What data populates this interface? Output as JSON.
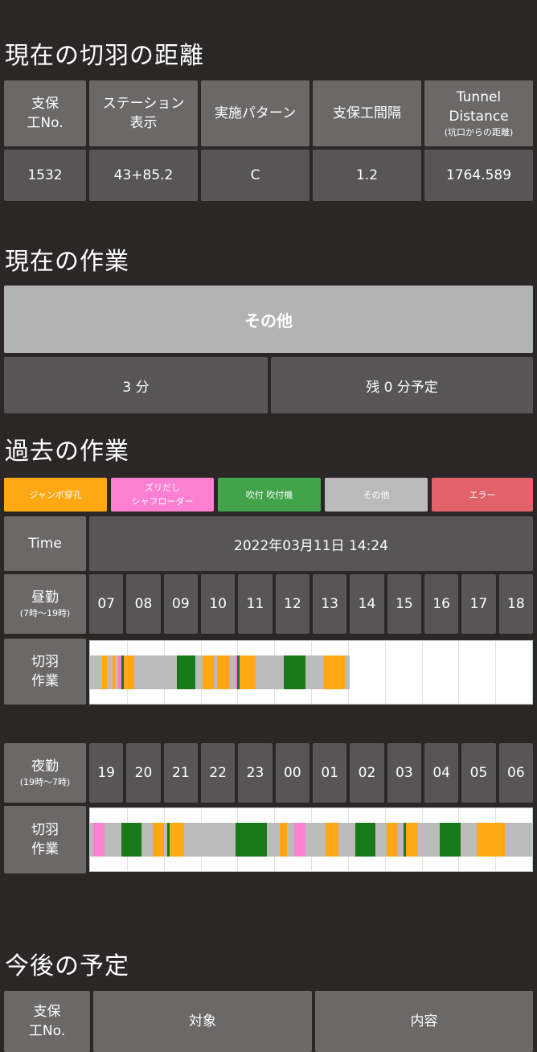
{
  "distance": {
    "title": "現在の切羽の距離",
    "headers": [
      {
        "line1": "支保",
        "line2": "工No.",
        "small": ""
      },
      {
        "line1": "ステーション",
        "line2": "表示",
        "small": ""
      },
      {
        "line1": "実施パターン",
        "line2": "",
        "small": ""
      },
      {
        "line1": "支保工間隔",
        "line2": "",
        "small": ""
      },
      {
        "line1": "Tunnel",
        "line2": "Distance",
        "small": "(坑口からの距離)"
      }
    ],
    "values": [
      "1532",
      "43+85.2",
      "C",
      "1.2",
      "1764.589"
    ]
  },
  "current_work": {
    "title": "現在の作業",
    "activity": "その他",
    "elapsed": "3 分",
    "remaining": "残 0 分予定"
  },
  "past_work": {
    "title": "過去の作業",
    "legend": [
      {
        "line1": "ジャンボ穿孔",
        "line2": "",
        "color": "#ffa814"
      },
      {
        "line1": "ズリだし",
        "line2": "シャフローダー",
        "color": "#fd7fd2"
      },
      {
        "line1": "吹付 吹付機",
        "line2": "",
        "color": "#42a44a"
      },
      {
        "line1": "その他",
        "line2": "",
        "color": "#bbbbbb"
      },
      {
        "line1": "エラー",
        "line2": "",
        "color": "#e2626a"
      }
    ],
    "time_label": "Time",
    "datetime": "2022年03月11日 14:24",
    "day": {
      "label": "昼勤",
      "sub": "(7時〜19時)",
      "row_label_1": "切羽",
      "row_label_2": "作業",
      "hours": [
        "07",
        "08",
        "09",
        "10",
        "11",
        "12",
        "13",
        "14",
        "15",
        "16",
        "17",
        "18"
      ]
    },
    "night": {
      "label": "夜勤",
      "sub": "(19時〜7時)",
      "row_label_1": "切羽",
      "row_label_2": "作業",
      "hours": [
        "19",
        "20",
        "21",
        "22",
        "23",
        "00",
        "01",
        "02",
        "03",
        "04",
        "05",
        "06"
      ]
    }
  },
  "future": {
    "title": "今後の予定",
    "col1_line1": "支保",
    "col1_line2": "工No.",
    "col2": "対象",
    "col3": "内容"
  },
  "chart_data": [
    {
      "type": "bar",
      "title": "",
      "xlabel": "",
      "ylabel": "",
      "x_range_hours": [
        7,
        19
      ],
      "note_units": "hours from 07:00",
      "segments": [
        {
          "start": 7.0,
          "end": 7.33,
          "activity": "その他",
          "color": "#bbbbbb"
        },
        {
          "start": 7.33,
          "end": 7.45,
          "activity": "ジャンボ穿孔",
          "color": "#ffa814"
        },
        {
          "start": 7.45,
          "end": 7.6,
          "activity": "その他",
          "color": "#bbbbbb"
        },
        {
          "start": 7.6,
          "end": 7.67,
          "activity": "ジャンボ穿孔",
          "color": "#ffa814"
        },
        {
          "start": 7.67,
          "end": 7.77,
          "activity": "その他",
          "color": "#bbbbbb"
        },
        {
          "start": 7.77,
          "end": 7.85,
          "activity": "ズリだし",
          "color": "#fd7fd2"
        },
        {
          "start": 7.85,
          "end": 7.92,
          "activity": "吹付",
          "color": "#1a7a1a"
        },
        {
          "start": 7.92,
          "end": 8.2,
          "activity": "ジャンボ穿孔",
          "color": "#ffa814"
        },
        {
          "start": 8.2,
          "end": 9.35,
          "activity": "その他",
          "color": "#bbbbbb"
        },
        {
          "start": 9.35,
          "end": 9.85,
          "activity": "吹付",
          "color": "#1a7a1a"
        },
        {
          "start": 9.85,
          "end": 10.05,
          "activity": "その他",
          "color": "#bbbbbb"
        },
        {
          "start": 10.05,
          "end": 10.35,
          "activity": "ジャンボ穿孔",
          "color": "#ffa814"
        },
        {
          "start": 10.35,
          "end": 10.45,
          "activity": "その他",
          "color": "#bbbbbb"
        },
        {
          "start": 10.45,
          "end": 10.8,
          "activity": "ジャンボ穿孔",
          "color": "#ffa814"
        },
        {
          "start": 10.8,
          "end": 10.95,
          "activity": "その他",
          "color": "#bbbbbb"
        },
        {
          "start": 10.95,
          "end": 11.0,
          "activity": "ズリだし",
          "color": "#fd7fd2"
        },
        {
          "start": 11.0,
          "end": 11.05,
          "activity": "吹付",
          "color": "#1a7a1a"
        },
        {
          "start": 11.05,
          "end": 11.5,
          "activity": "ジャンボ穿孔",
          "color": "#ffa814"
        },
        {
          "start": 11.5,
          "end": 12.25,
          "activity": "その他",
          "color": "#bbbbbb"
        },
        {
          "start": 12.25,
          "end": 12.85,
          "activity": "吹付",
          "color": "#1a7a1a"
        },
        {
          "start": 12.85,
          "end": 13.35,
          "activity": "その他",
          "color": "#bbbbbb"
        },
        {
          "start": 13.35,
          "end": 13.92,
          "activity": "ジャンボ穿孔",
          "color": "#ffa814"
        },
        {
          "start": 13.92,
          "end": 14.05,
          "activity": "その他",
          "color": "#bbbbbb"
        }
      ]
    },
    {
      "type": "bar",
      "title": "",
      "xlabel": "",
      "ylabel": "",
      "x_range_hours": [
        0,
        12
      ],
      "note_units": "hours from 19:00",
      "segments": [
        {
          "start": 0.0,
          "end": 0.08,
          "activity": "その他",
          "color": "#bbbbbb"
        },
        {
          "start": 0.08,
          "end": 0.4,
          "activity": "ズリだし",
          "color": "#fd7fd2"
        },
        {
          "start": 0.4,
          "end": 0.85,
          "activity": "その他",
          "color": "#bbbbbb"
        },
        {
          "start": 0.85,
          "end": 1.4,
          "activity": "吹付",
          "color": "#1a7a1a"
        },
        {
          "start": 1.4,
          "end": 1.7,
          "activity": "その他",
          "color": "#bbbbbb"
        },
        {
          "start": 1.7,
          "end": 2.0,
          "activity": "ジャンボ穿孔",
          "color": "#ffa814"
        },
        {
          "start": 2.0,
          "end": 2.1,
          "activity": "その他",
          "color": "#bbbbbb"
        },
        {
          "start": 2.1,
          "end": 2.17,
          "activity": "吹付",
          "color": "#1a7a1a"
        },
        {
          "start": 2.17,
          "end": 2.55,
          "activity": "ジャンボ穿孔",
          "color": "#ffa814"
        },
        {
          "start": 2.55,
          "end": 3.95,
          "activity": "その他",
          "color": "#bbbbbb"
        },
        {
          "start": 3.95,
          "end": 4.8,
          "activity": "吹付",
          "color": "#1a7a1a"
        },
        {
          "start": 4.8,
          "end": 5.15,
          "activity": "その他",
          "color": "#bbbbbb"
        },
        {
          "start": 5.15,
          "end": 5.35,
          "activity": "ジャンボ穿孔",
          "color": "#ffa814"
        },
        {
          "start": 5.35,
          "end": 5.55,
          "activity": "その他",
          "color": "#bbbbbb"
        },
        {
          "start": 5.55,
          "end": 5.85,
          "activity": "ズリだし",
          "color": "#fd7fd2"
        },
        {
          "start": 5.85,
          "end": 6.4,
          "activity": "その他",
          "color": "#bbbbbb"
        },
        {
          "start": 6.4,
          "end": 6.75,
          "activity": "ジャンボ穿孔",
          "color": "#ffa814"
        },
        {
          "start": 6.75,
          "end": 7.2,
          "activity": "その他",
          "color": "#bbbbbb"
        },
        {
          "start": 7.2,
          "end": 7.75,
          "activity": "吹付",
          "color": "#1a7a1a"
        },
        {
          "start": 7.75,
          "end": 8.05,
          "activity": "その他",
          "color": "#bbbbbb"
        },
        {
          "start": 8.05,
          "end": 8.35,
          "activity": "ジャンボ穿孔",
          "color": "#ffa814"
        },
        {
          "start": 8.35,
          "end": 8.5,
          "activity": "その他",
          "color": "#bbbbbb"
        },
        {
          "start": 8.5,
          "end": 8.58,
          "activity": "吹付",
          "color": "#1a7a1a"
        },
        {
          "start": 8.58,
          "end": 8.9,
          "activity": "ジャンボ穿孔",
          "color": "#ffa814"
        },
        {
          "start": 8.9,
          "end": 9.5,
          "activity": "その他",
          "color": "#bbbbbb"
        },
        {
          "start": 9.5,
          "end": 10.05,
          "activity": "吹付",
          "color": "#1a7a1a"
        },
        {
          "start": 10.05,
          "end": 10.5,
          "activity": "その他",
          "color": "#bbbbbb"
        },
        {
          "start": 10.5,
          "end": 11.25,
          "activity": "ジャンボ穿孔",
          "color": "#ffa814"
        },
        {
          "start": 11.25,
          "end": 12.0,
          "activity": "その他",
          "color": "#bbbbbb"
        }
      ]
    }
  ]
}
